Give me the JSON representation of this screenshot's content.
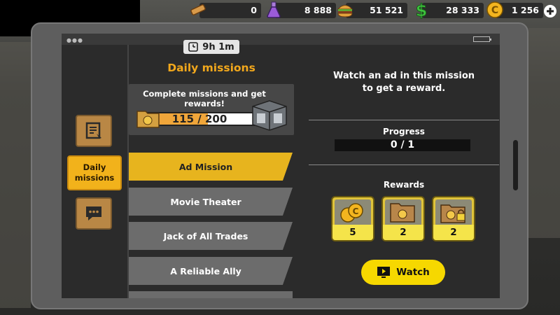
{
  "currencies": [
    {
      "icon": "wood-plank-icon",
      "value": "0"
    },
    {
      "icon": "potion-flask-icon",
      "value": "8 888"
    },
    {
      "icon": "burger-icon",
      "value": "51 521"
    },
    {
      "icon": "dollar-icon",
      "value": "28 333"
    },
    {
      "icon": "coin-icon",
      "value": "1 256"
    }
  ],
  "timer": {
    "value": "9h 1m"
  },
  "panel": {
    "title": "Daily missions",
    "reward_text": "Complete missions and get rewards!",
    "progress_text": "115 / 200",
    "progress_fraction": 0.575
  },
  "side_menu": {
    "active_label": "Daily missions"
  },
  "missions": [
    {
      "label": "Ad Mission",
      "active": true
    },
    {
      "label": "Movie Theater",
      "active": false
    },
    {
      "label": "Jack of All Trades",
      "active": false
    },
    {
      "label": "A Reliable Ally",
      "active": false
    }
  ],
  "detail": {
    "description": "Watch an ad in this mission to get a reward.",
    "progress_label": "Progress",
    "progress_value": "0 / 1",
    "rewards_label": "Rewards",
    "rewards": [
      {
        "icon": "coins-icon",
        "count": "5"
      },
      {
        "icon": "folder-icon",
        "count": "2"
      },
      {
        "icon": "locked-folder-icon",
        "count": "2"
      }
    ],
    "watch_label": "Watch"
  },
  "colors": {
    "accent": "#f2a81c",
    "active_tab": "#e7b41e",
    "watch": "#f6d800"
  }
}
